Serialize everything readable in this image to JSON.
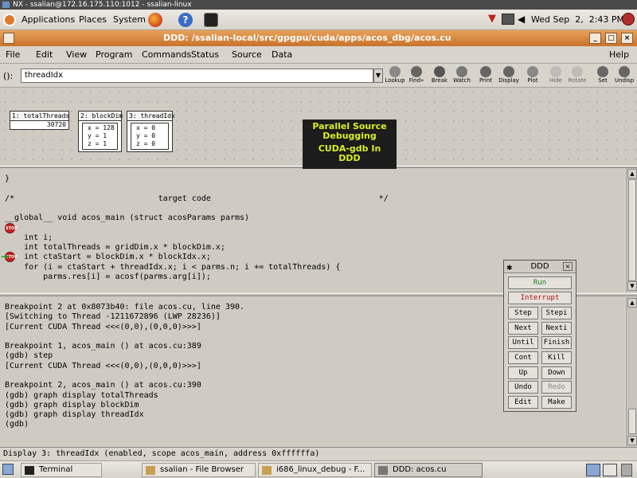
{
  "titlebar": {
    "text": "NX - ssalian@172.16.175.110:1012 - ssalian-linux"
  },
  "panel": {
    "menus": [
      "Applications",
      "Places",
      "System"
    ],
    "clock": "Wed Sep  2,  2:43 PM"
  },
  "window": {
    "title": "DDD: /ssalian-local/src/gpgpu/cuda/apps/acos_dbg/acos.cu"
  },
  "menubar": {
    "items": [
      "File",
      "Edit",
      "View",
      "Program",
      "Commands",
      "Status",
      "Source",
      "Data"
    ],
    "help": "Help"
  },
  "argument": {
    "label": "():",
    "value": "threadIdx"
  },
  "toolbar": {
    "tools": [
      "Lookup",
      "Find»",
      "Break",
      "Watch",
      "Print",
      "Display",
      "Plot",
      "Hide",
      "Rotate",
      "Set",
      "Undisp"
    ]
  },
  "graph": {
    "nodes": [
      {
        "title": "1: totalThreads",
        "lines": [
          "30720"
        ]
      },
      {
        "title": "2: blockDim",
        "lines": [
          "x = 128",
          "y = 1",
          "z = 1"
        ]
      },
      {
        "title": "3: threadIdx",
        "lines": [
          "x = 0",
          "y = 0",
          "z = 0"
        ]
      }
    ]
  },
  "overlay": {
    "line1": "Parallel Source",
    "line2": "Debugging",
    "line3": "CUDA-gdb In",
    "line4": "DDD"
  },
  "source": {
    "lines": [
      "}",
      "",
      "/*                              target code                                   */",
      "",
      "__global__ void acos_main (struct acosParams parms)",
      "{",
      "    int i;",
      "    int totalThreads = gridDim.x * blockDim.x;",
      "    int ctaStart = blockDim.x * blockIdx.x;",
      "    for (i = ctaStart + threadIdx.x; i < parms.n; i += totalThreads) {",
      "        parms.res[i] = acosf(parms.arg[i]);"
    ]
  },
  "console": {
    "lines": [
      "Breakpoint 2 at 0x8073b40: file acos.cu, line 390.",
      "[Switching to Thread -1211672896 (LWP 28236)]",
      "[Current CUDA Thread <<<(0,0),(0,0,0)>>>]",
      "",
      "Breakpoint 1, acos_main () at acos.cu:389",
      "(gdb) step",
      "[Current CUDA Thread <<<(0,0),(0,0,0)>>>]",
      "",
      "Breakpoint 2, acos_main () at acos.cu:390",
      "(gdb) graph display totalThreads",
      "(gdb) graph display blockDim",
      "(gdb) graph display threadIdx",
      "(gdb)"
    ]
  },
  "command_tool": {
    "title": "DDD",
    "run": "Run",
    "interrupt": "Interrupt",
    "buttons": [
      "Step",
      "Stepi",
      "Next",
      "Nexti",
      "Until",
      "Finish",
      "Cont",
      "Kill",
      "Up",
      "Down",
      "Undo",
      "Redo",
      "Edit",
      "Make"
    ]
  },
  "status": {
    "text": "Display 3: threadIdx (enabled, scope acos_main, address 0xffffffa)"
  },
  "taskbar": {
    "tasks": [
      "Terminal",
      "ssalian - File Browser",
      "i686_linux_debug - F...",
      "DDD: acos.cu"
    ]
  },
  "colors": {
    "title_orange": "#d8843a",
    "overlay_text": "#d8f020",
    "stop": "#c82020",
    "pc_arrow": "#1f9a1f"
  }
}
